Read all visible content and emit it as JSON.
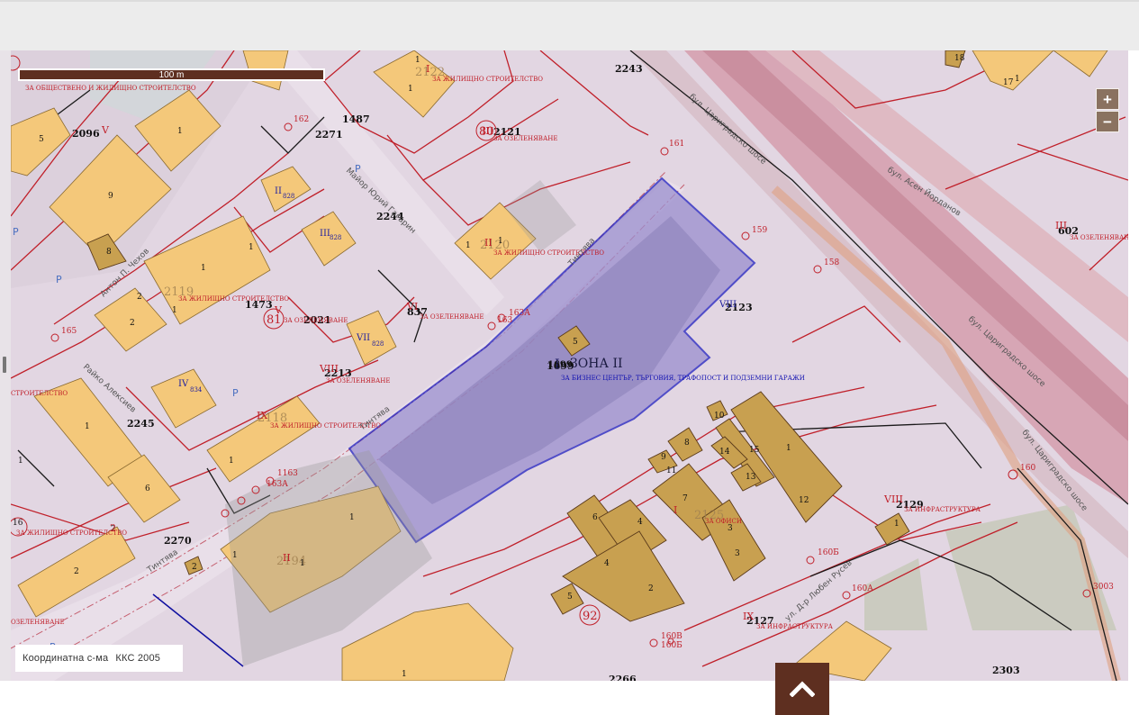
{
  "scale": {
    "label": "100 m"
  },
  "zoom": {
    "in_label": "+",
    "out_label": "−"
  },
  "coordinate_system": {
    "label": "Координатна с-ма",
    "value": "ККС 2005"
  },
  "zone": {
    "numeral": "I",
    "name": "ЗОНА II",
    "id": "1699",
    "purpose": "ЗА БИЗНЕС ЦЕНТЪР, ТЪРГОВИЯ, ТРАФОПОСТ И ПОДЗЕМНИ ГАРАЖИ"
  },
  "streets": [
    "бул. Цариградско шосе",
    "бул. Асен Йорданов",
    "Майор Юрий Гагарин",
    "Тинтява",
    "Антон П. Чехов",
    "Райко Алексиев",
    "ул. Д-р Любен Русев"
  ],
  "parcels": [
    "2243",
    "2096",
    "2271",
    "1487",
    "2121",
    "2244",
    "1473",
    "2021",
    "837",
    "2213",
    "2123",
    "2245",
    "2270",
    "2129",
    "2127",
    "2303",
    "2266",
    "602",
    "2122",
    "2120",
    "2119",
    "2118",
    "2194"
  ],
  "purposes": {
    "housing": "ЗА ЖИЛИЩНО СТРОИТЕЛСТВО",
    "public_housing": "ЗА ОБЩЕСТВЕНО И ЖИЛИЩНО СТРОИТЕЛСТВО",
    "greening": "ЗА ОЗЕЛЕНЯВАНЕ",
    "offices": "ЗА ОФИСИ",
    "infrastructure": "ЗА ИНФРАСТРУКТУРА"
  },
  "blocks": [
    "80",
    "81",
    "92"
  ],
  "points": [
    "162",
    "161",
    "159",
    "158",
    "165",
    "163",
    "163А",
    "1163",
    "163А",
    "160Б",
    "160А",
    "160В",
    "160Б",
    "3003",
    "160"
  ]
}
